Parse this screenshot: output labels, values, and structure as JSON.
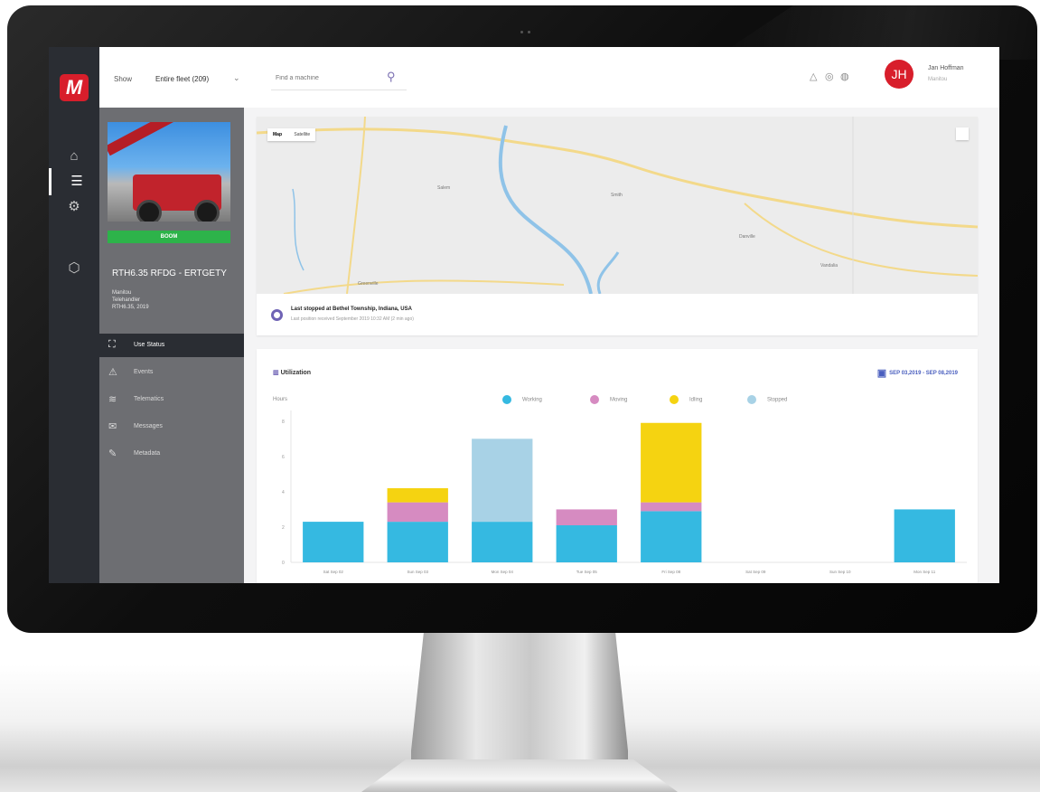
{
  "topbar": {
    "show_label": "Show",
    "fleet_value": "Entire fleet (209)",
    "search_placeholder": "Find a machine",
    "user_initials": "JH",
    "user_name": "Jan Hoffman",
    "user_role": "Manitou"
  },
  "machine": {
    "status": "BOOM",
    "name": "RTH6.35 RFDG - ERTGETY",
    "meta": [
      "Manitou",
      "Telehandler",
      "RTH6.35, 2019"
    ]
  },
  "panel_nav": [
    {
      "label": "Use Status",
      "icon": "chart-icon",
      "glyph": "⛶",
      "active": true
    },
    {
      "label": "Events",
      "icon": "alert-icon",
      "glyph": "⚠",
      "active": false
    },
    {
      "label": "Telematics",
      "icon": "wifi-icon",
      "glyph": "≋",
      "active": false
    },
    {
      "label": "Messages",
      "icon": "message-icon",
      "glyph": "✉",
      "active": false
    },
    {
      "label": "Metadata",
      "icon": "edit-icon",
      "glyph": "✎",
      "active": false
    }
  ],
  "map": {
    "tabs": [
      "Map",
      "Satellite"
    ],
    "place_labels": [
      "Salem",
      "Smith",
      "Greenville",
      "Danville",
      "Vandalia"
    ]
  },
  "location": {
    "title": "Last stopped at Bethel Township, Indiana, USA",
    "subtitle": "Last position received September 2019 10:32 AM (2 min ago)"
  },
  "chart": {
    "title": "Utilization",
    "date_range": "SEP 03,2019 - SEP 08,2019",
    "ylabel": "Hours"
  },
  "chart_data": {
    "type": "bar",
    "stacked": true,
    "categories": [
      "Sat Sep 02",
      "Sun Sep 03",
      "Mon Sep 04",
      "Tue Sep 05",
      "Fri Sep 08",
      "Sat Sep 09",
      "Sun Sep 10",
      "Mon Sep 11"
    ],
    "series": [
      {
        "name": "Working",
        "color": "#35b9e1",
        "values": [
          2.3,
          2.3,
          2.3,
          2.1,
          2.9,
          0,
          0,
          3.0
        ]
      },
      {
        "name": "Moving",
        "color": "#d68bc1",
        "values": [
          0,
          1.1,
          0,
          0.9,
          0.5,
          0,
          0,
          0
        ]
      },
      {
        "name": "Idling",
        "color": "#f5d311",
        "values": [
          0,
          0.8,
          0,
          0,
          4.5,
          0,
          0,
          0
        ]
      },
      {
        "name": "Stopped",
        "color": "#a8d2e6",
        "values": [
          0,
          0,
          4.7,
          0,
          0,
          0,
          0,
          0
        ]
      }
    ],
    "yticks": [
      0,
      2,
      4,
      6,
      8
    ],
    "ylim": [
      0,
      8.4
    ],
    "legend_position": "top",
    "grid": false
  }
}
